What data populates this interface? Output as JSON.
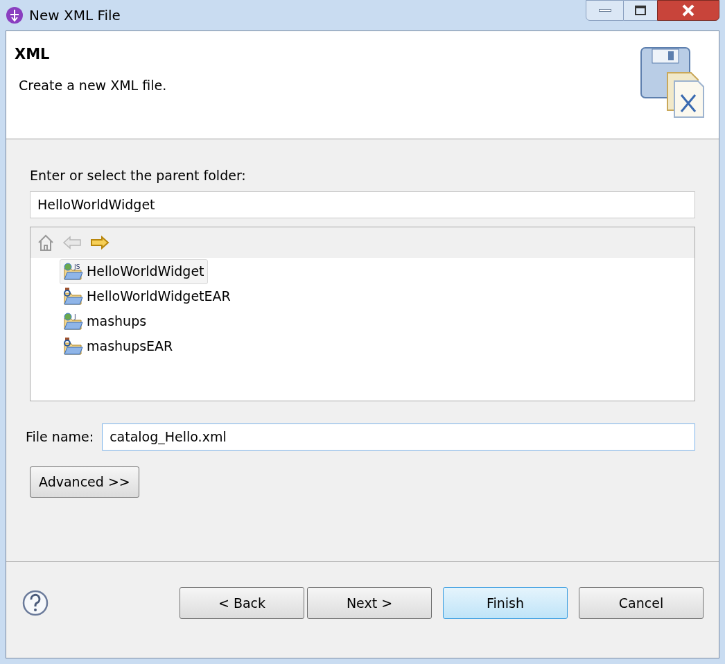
{
  "window": {
    "title": "New XML File"
  },
  "header": {
    "title": "XML",
    "description": "Create a new XML file."
  },
  "parent_folder": {
    "label": "Enter or select the parent folder:",
    "value": "HelloWorldWidget"
  },
  "tree_toolbar": [
    {
      "kind": "home",
      "disabled": true
    },
    {
      "kind": "back",
      "disabled": true
    },
    {
      "kind": "forward",
      "disabled": false
    }
  ],
  "tree": [
    {
      "label": "HelloWorldWidget",
      "kind": "web",
      "badge": "JS",
      "selected": true
    },
    {
      "label": "HelloWorldWidgetEAR",
      "kind": "ear",
      "selected": false
    },
    {
      "label": "mashups",
      "kind": "web",
      "badge": "J",
      "selected": false
    },
    {
      "label": "mashupsEAR",
      "kind": "ear",
      "selected": false
    }
  ],
  "file_name": {
    "label": "File name:",
    "value": "catalog_Hello.xml"
  },
  "advanced_button": {
    "label": "Advanced >>"
  },
  "buttons": [
    {
      "label": "< Back",
      "default": false
    },
    {
      "label": "Next >",
      "default": false
    },
    {
      "label": "Finish",
      "default": true
    },
    {
      "label": "Cancel",
      "default": false
    }
  ]
}
